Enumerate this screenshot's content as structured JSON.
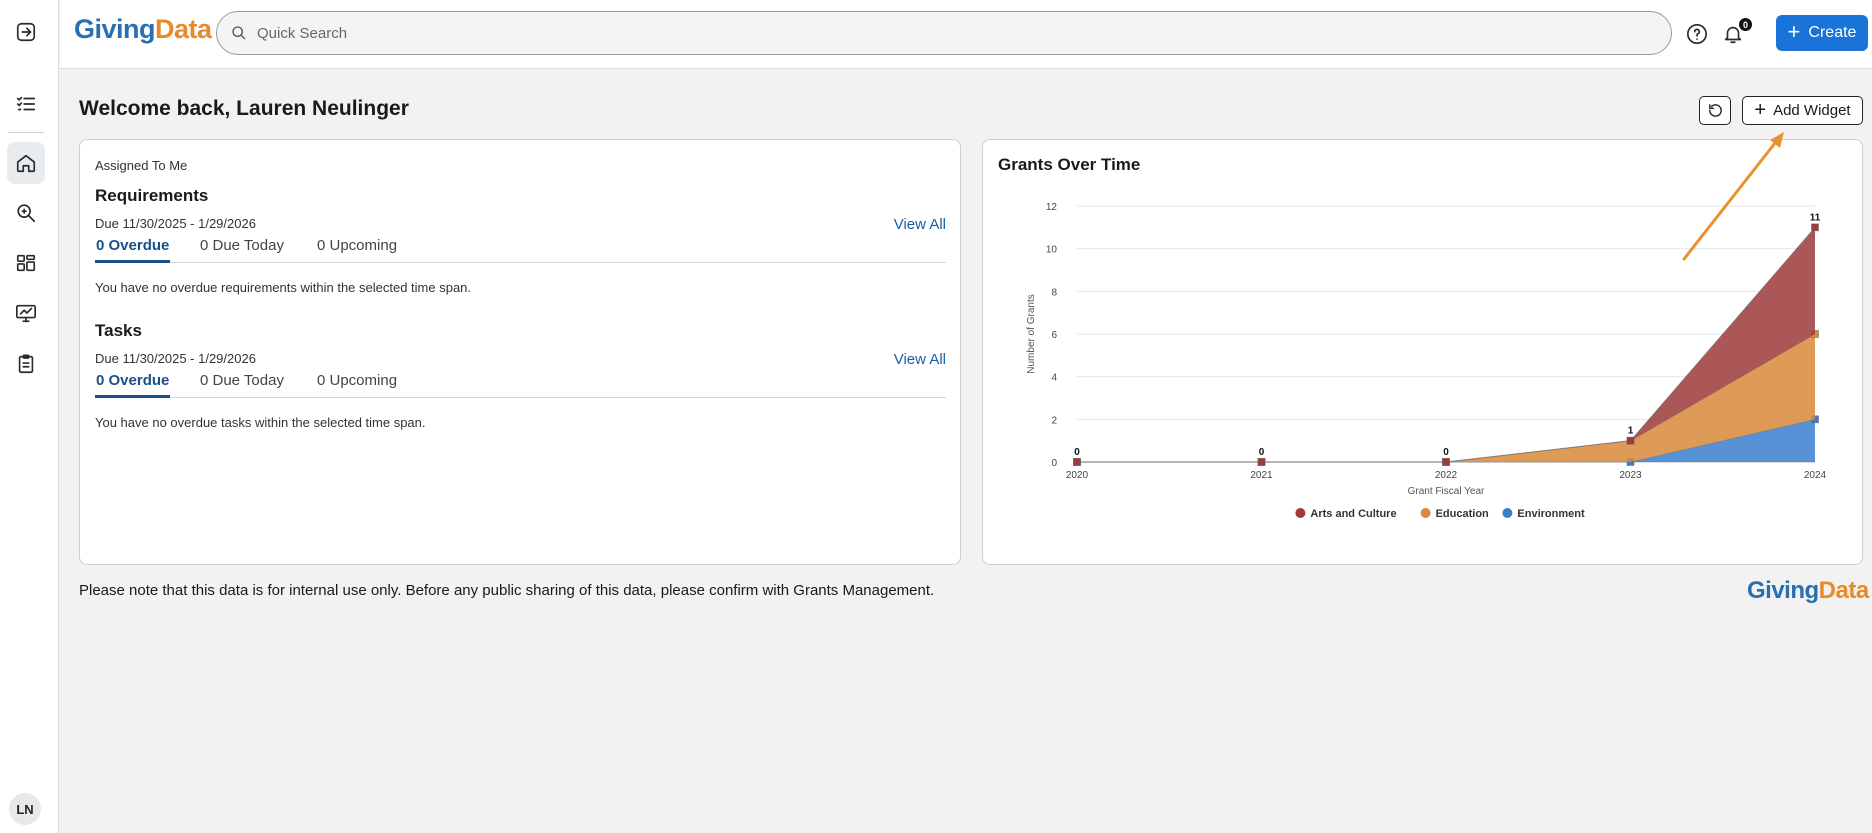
{
  "app": {
    "logo_part1": "Giving",
    "logo_part2": "Data"
  },
  "search": {
    "placeholder": "Quick Search"
  },
  "header": {
    "notifications_count": "0",
    "create_label": "Create"
  },
  "sidebar": {
    "items": [
      {
        "name": "expand"
      },
      {
        "name": "tasks"
      },
      {
        "name": "home"
      },
      {
        "name": "search"
      },
      {
        "name": "dashboards"
      },
      {
        "name": "reports"
      },
      {
        "name": "clipboard"
      }
    ],
    "avatar_initials": "LN"
  },
  "page": {
    "welcome": "Welcome back, Lauren Neulinger",
    "add_widget_label": "Add Widget"
  },
  "assigned": {
    "heading": "Assigned To Me",
    "requirements": {
      "title": "Requirements",
      "due": "Due 11/30/2025 - 1/29/2026",
      "view_all": "View All",
      "tabs": [
        "0 Overdue",
        "0 Due Today",
        "0 Upcoming"
      ],
      "empty": "You have no overdue requirements within the selected time span."
    },
    "tasks": {
      "title": "Tasks",
      "due": "Due 11/30/2025 - 1/29/2026",
      "view_all": "View All",
      "tabs": [
        "0 Overdue",
        "0 Due Today",
        "0 Upcoming"
      ],
      "empty": "You have no overdue tasks within the selected time span."
    }
  },
  "chart_data": {
    "type": "area",
    "title": "Grants Over Time",
    "xlabel": "Grant Fiscal Year",
    "ylabel": "Number of Grants",
    "x": [
      "2020",
      "2021",
      "2022",
      "2023",
      "2024"
    ],
    "ylim": [
      0,
      12
    ],
    "yticks": [
      "0",
      "2",
      "4",
      "6",
      "8",
      "10",
      "12"
    ],
    "stacked": true,
    "series": [
      {
        "name": "Environment",
        "color": "#3a7fcf",
        "values": [
          0,
          0,
          0,
          0,
          2
        ]
      },
      {
        "name": "Education",
        "color": "#d8893a",
        "values": [
          0,
          0,
          0,
          1,
          4
        ]
      },
      {
        "name": "Arts and Culture",
        "color": "#9e3a3a",
        "values": [
          0,
          0,
          0,
          0,
          5
        ]
      }
    ],
    "total_labels": [
      "0",
      "0",
      "0",
      "1",
      "11"
    ],
    "legend": [
      "Arts and Culture",
      "Education",
      "Environment"
    ],
    "legend_colors": [
      "#9e3a3a",
      "#d8893a",
      "#3a7fcf"
    ],
    "legend_position": "bottom",
    "grid": true
  },
  "footer": {
    "note": "Please note that this data is for internal use only. Before any public sharing of this data, please confirm with Grants Management.",
    "logo_part1": "Giving",
    "logo_part2": "Data"
  },
  "colors": {
    "accent": "#1a73d9",
    "tab_active": "#1a4f8a",
    "annotation_arrow": "#e8922e"
  }
}
